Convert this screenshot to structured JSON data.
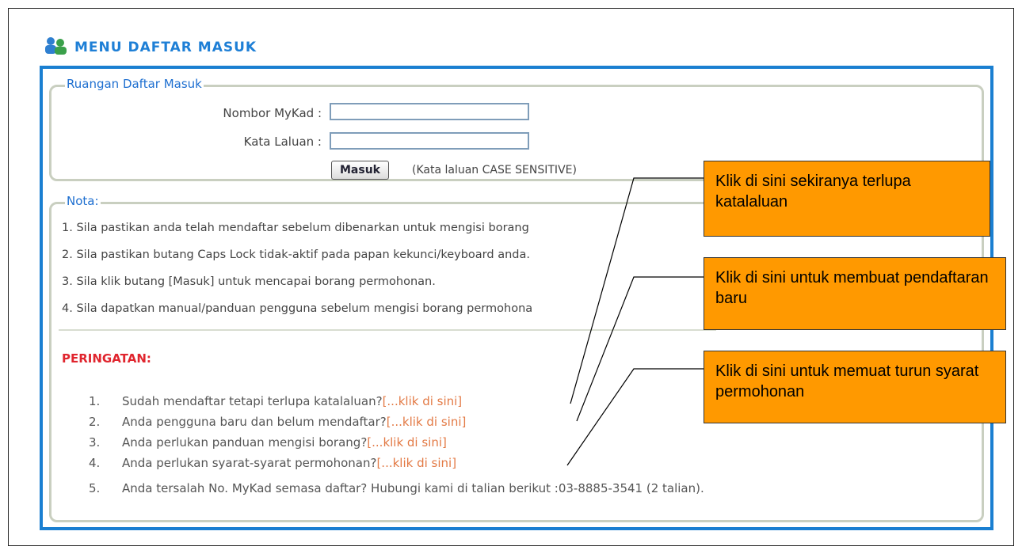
{
  "header": {
    "title": "MENU DAFTAR MASUK",
    "icon": "users-icon"
  },
  "login": {
    "legend": "Ruangan Daftar Masuk",
    "mykad_label": "Nombor MyKad :",
    "password_label": "Kata Laluan :",
    "mykad_value": "",
    "password_value": "",
    "submit_label": "Masuk",
    "case_note": "(Kata laluan CASE SENSITIVE)"
  },
  "notes": {
    "legend": "Nota:",
    "items": [
      "1. Sila pastikan anda telah mendaftar sebelum dibenarkan untuk mengisi borang",
      "2. Sila pastikan butang Caps Lock tidak-aktif pada papan kekunci/keyboard anda.",
      "3. Sila klik butang [Masuk] untuk mencapai borang permohonan.",
      "4. Sila dapatkan manual/panduan pengguna sebelum mengisi borang permohona"
    ]
  },
  "warning": {
    "title": "PERINGATAN:",
    "items": [
      {
        "num": "1.",
        "text": "Sudah mendaftar tetapi terlupa katalaluan?",
        "link": "[...klik di sini]"
      },
      {
        "num": "2.",
        "text": "Anda pengguna baru dan belum mendaftar?",
        "link": "[...klik di sini]"
      },
      {
        "num": "3.",
        "text": "Anda perlukan panduan mengisi borang?",
        "link": "[...klik di sini]"
      },
      {
        "num": "4.",
        "text": "Anda perlukan syarat-syarat permohonan?",
        "link": "[...klik di sini]"
      },
      {
        "num": "5.",
        "text": "Anda tersalah No. MyKad semasa daftar? Hubungi kami di talian berikut :03-8885-3541 (2 talian).",
        "link": ""
      }
    ]
  },
  "callouts": [
    "Klik di sini sekiranya terlupa katalaluan",
    "Klik di sini untuk membuat pendaftaran baru",
    "Klik di sini untuk memuat turun syarat permohonan"
  ],
  "colors": {
    "accent": "#1a7fd1",
    "warning": "#e0252e",
    "link": "#e37a45",
    "callout": "#ff9900"
  }
}
